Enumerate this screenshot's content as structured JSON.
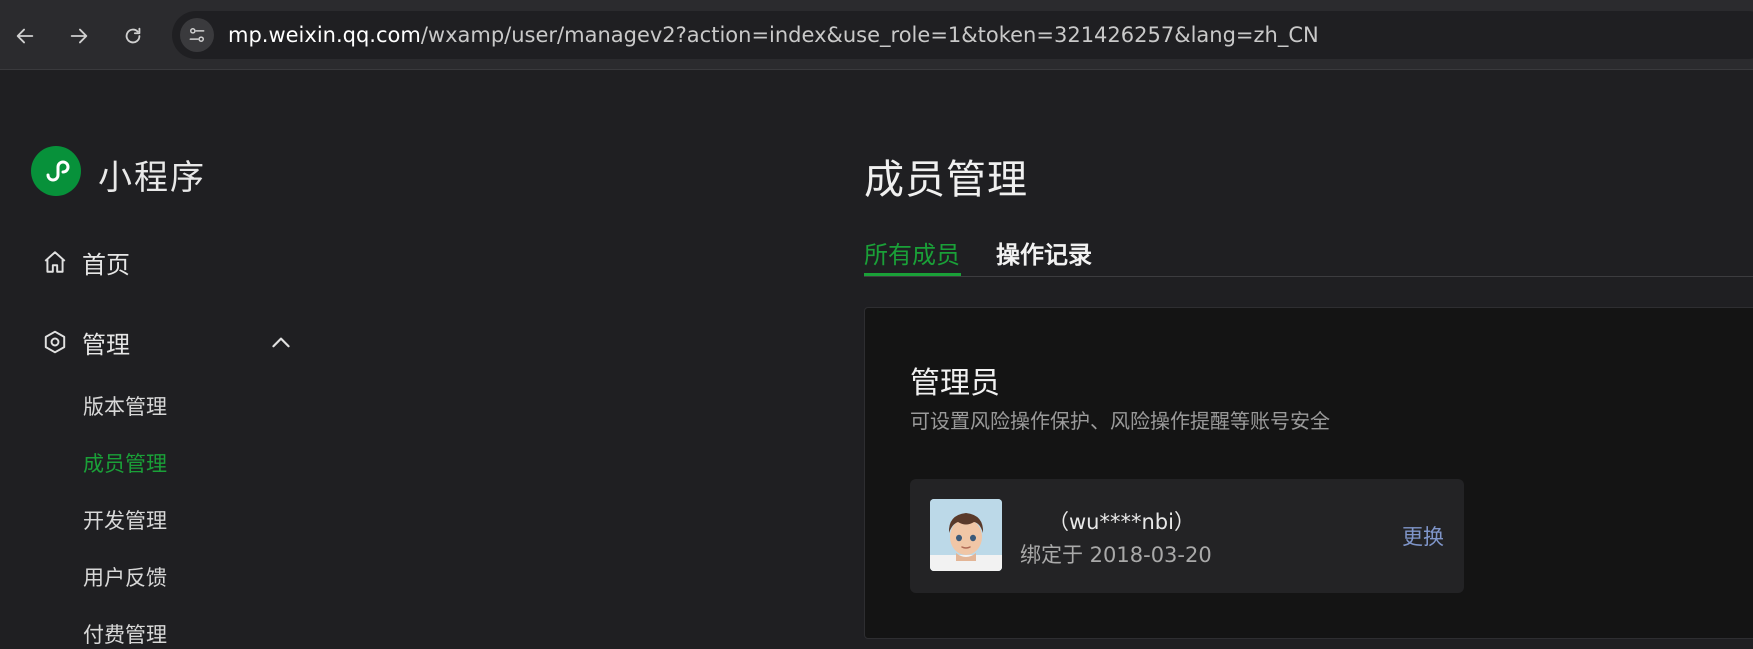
{
  "browser": {
    "url_host": "mp.weixin.qq.com",
    "url_path": "/wxamp/user/managev2?action=index&use_role=1&token=321426257&lang=zh_CN",
    "icons": [
      "back-icon",
      "forward-icon",
      "reload-icon",
      "site-info-icon"
    ]
  },
  "sidebar": {
    "app_name": "小程序",
    "home_label": "首页",
    "manage_label": "管理",
    "sub_items": [
      "版本管理",
      "成员管理",
      "开发管理",
      "用户反馈",
      "付费管理"
    ],
    "active_sub_item": "成员管理"
  },
  "main": {
    "title": "成员管理",
    "tabs": [
      "所有成员",
      "操作记录"
    ],
    "active_tab": "所有成员",
    "admin_card": {
      "title": "管理员",
      "description": "可设置风险操作保护、风险操作提醒等账号安全",
      "member": {
        "name": "（wu****nbi）",
        "bind_text": "绑定于 2018-03-20",
        "action_label": "更换"
      }
    }
  },
  "colors": {
    "accent_green": "#1aa038",
    "link_blue": "#7f95c9",
    "background": "#1f1f22"
  }
}
